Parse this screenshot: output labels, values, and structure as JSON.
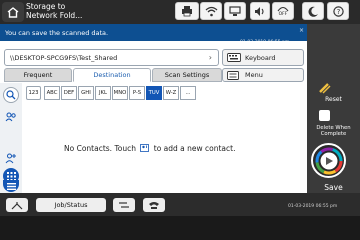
{
  "header": {
    "title_line1": "Storage to",
    "title_line2": "Network Fold..."
  },
  "notice": {
    "message": "You can save the scanned data.",
    "close_label": "×"
  },
  "datetime_top": "01-03-2019  06:55 pm",
  "path": {
    "value": "\\\\DESKTOP-SPCG9FS\\Test_Shared"
  },
  "buttons": {
    "keyboard": "Keyboard",
    "menu": "Menu",
    "reset": "Reset",
    "delete_when_complete_line1": "Delete When",
    "delete_when_complete_line2": "Complete",
    "save": "Save",
    "job_status": "Job/Status"
  },
  "tabs": [
    {
      "label": "Frequent"
    },
    {
      "label": "Destination"
    },
    {
      "label": "Scan Settings"
    }
  ],
  "letters": [
    "123",
    "ABC",
    "DEF",
    "GHI",
    "JKL",
    "MNO",
    "P-S",
    "TUV",
    "W-Z",
    "..."
  ],
  "empty_message": {
    "before": "No Contacts. Touch",
    "after": "to add a new contact."
  },
  "datetime_bottom": "01-03-2019  06:55 pm",
  "icons": {
    "home": "home-icon",
    "wifi": "wifi-icon",
    "volume": "volume-icon",
    "eco_off": "eco-off-icon",
    "moon": "sleep-icon",
    "help": "help-icon"
  },
  "status_texts": {
    "eco": "OFF"
  },
  "colors": {
    "accent": "#1356b5",
    "notice_bg": "#0d4f91",
    "rail_bg": "#3a3a3a"
  }
}
